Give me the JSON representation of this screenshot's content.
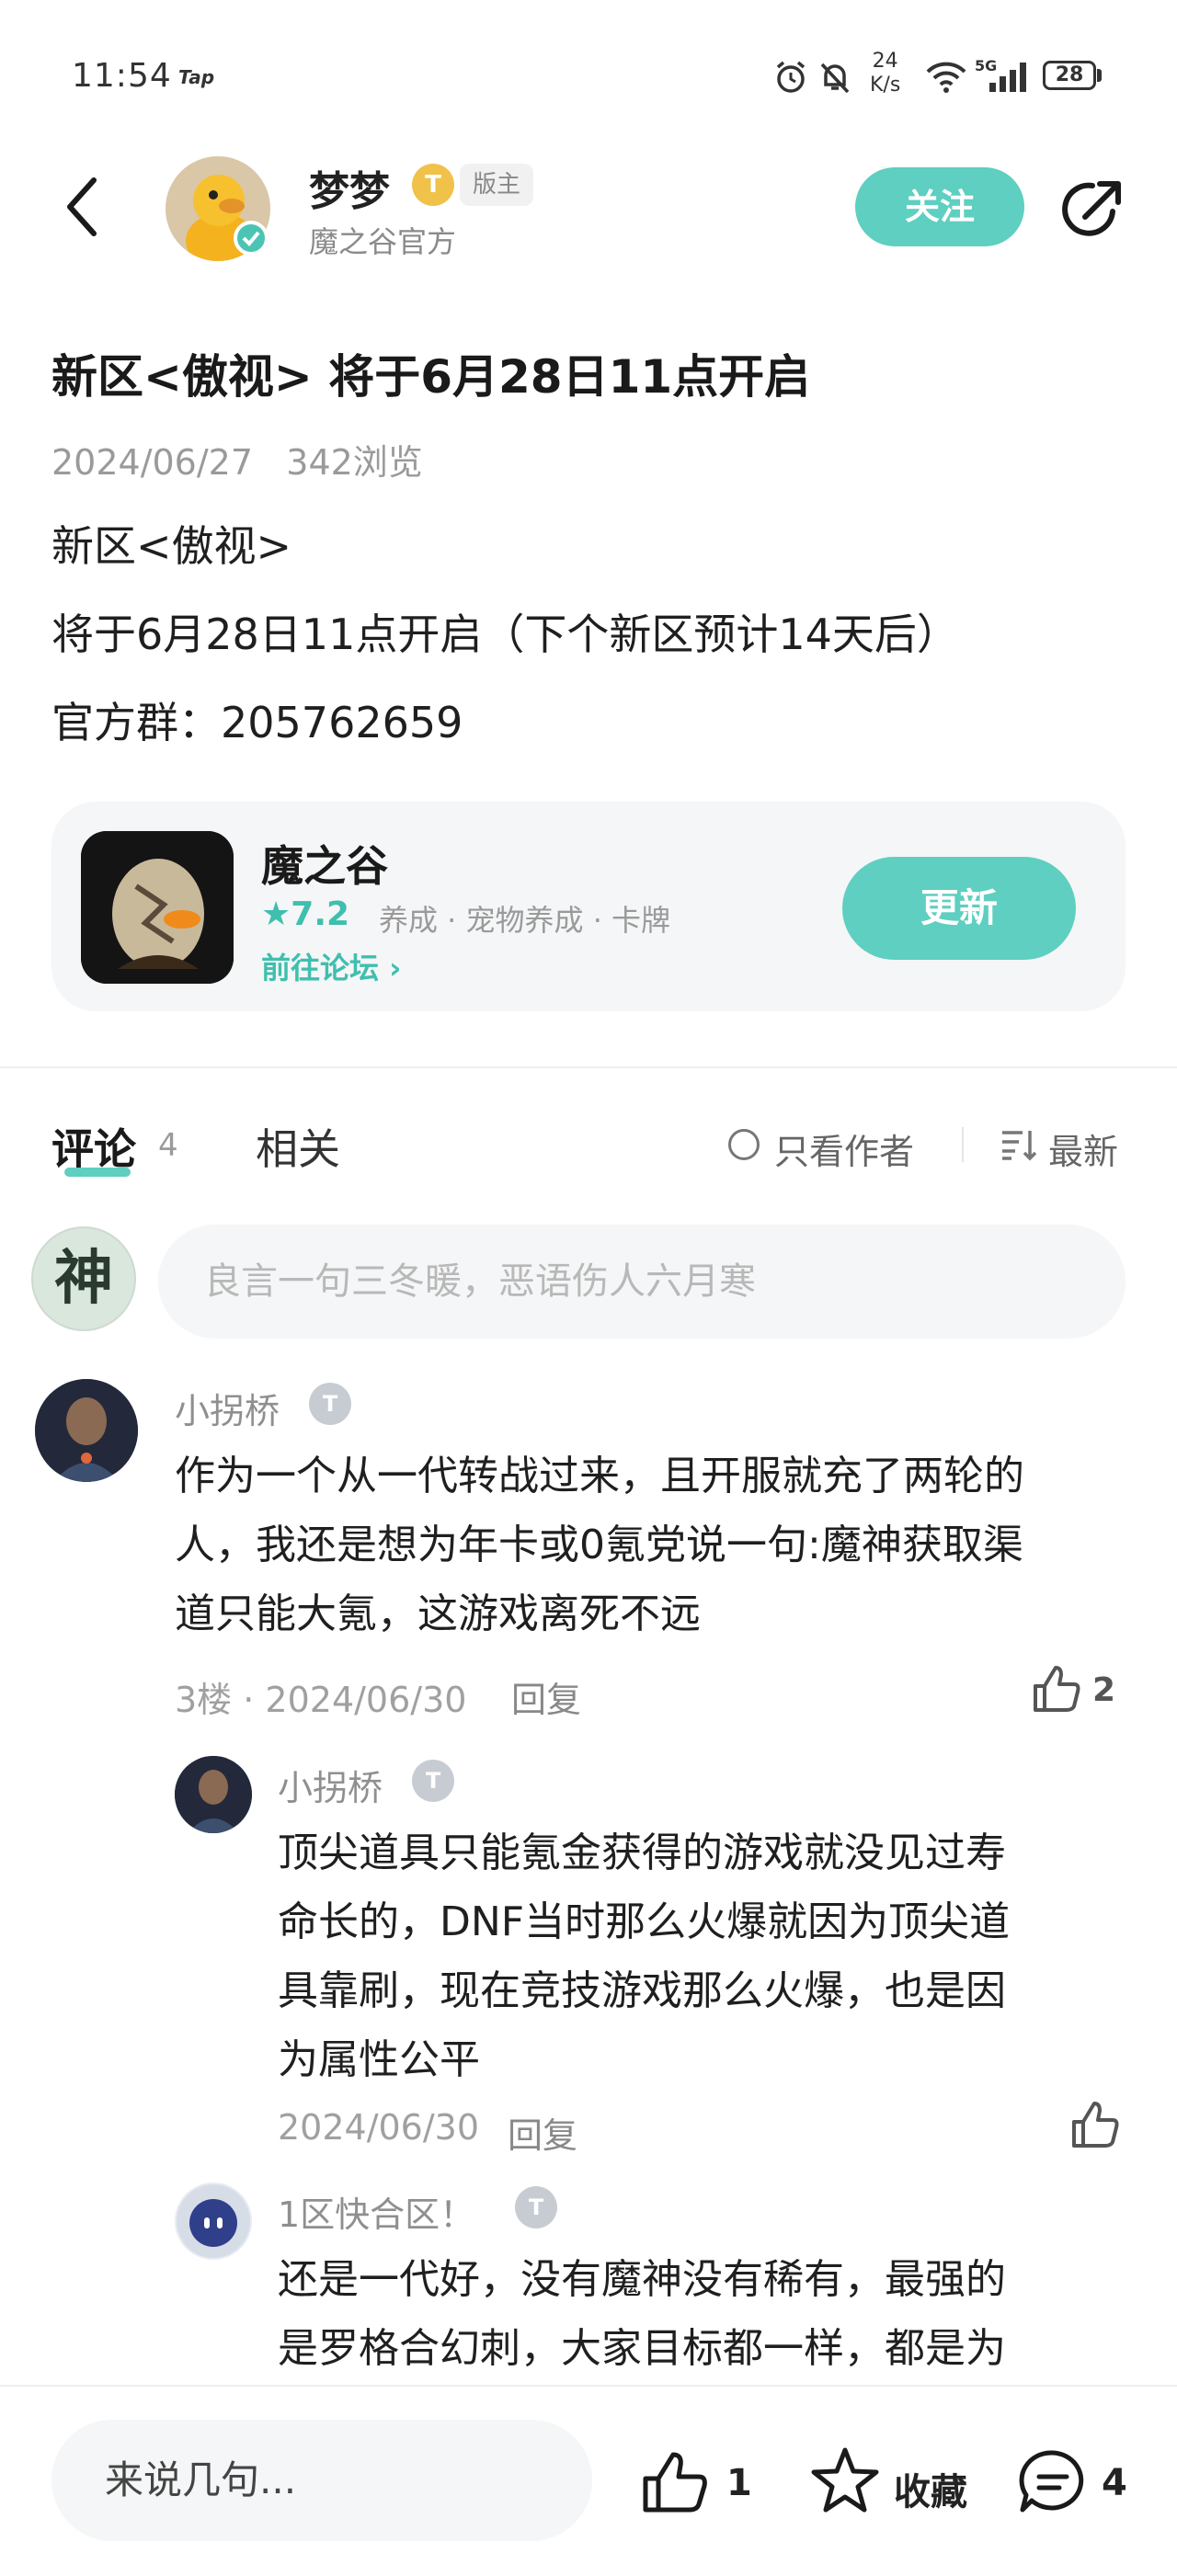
{
  "status_bar": {
    "time": "11:54",
    "tap_label": "Tap",
    "net_speed_value": "24",
    "net_speed_unit": "K/s",
    "network": "5G",
    "battery": "28"
  },
  "header": {
    "author_name": "梦梦",
    "level_badge": "T",
    "role_badge": "版主",
    "author_sub": "魔之谷官方",
    "follow_label": "关注"
  },
  "article": {
    "title": "新区<傲视> 将于6月28日11点开启",
    "date": "2024/06/27",
    "views": "342浏览",
    "body_lines": [
      "新区<傲视>",
      "将于6月28日11点开启（下个新区预计14天后）",
      "官方群：205762659"
    ]
  },
  "app_card": {
    "name": "魔之谷",
    "rating": "★7.2",
    "tags": "养成 · 宠物养成 · 卡牌",
    "forum_link": "前往论坛 ›",
    "update_label": "更新"
  },
  "tabs": {
    "comments_label": "评论",
    "comments_count": "4",
    "related_label": "相关",
    "author_only_label": "只看作者",
    "sort_label": "最新"
  },
  "comment_input": {
    "avatar_char": "神",
    "placeholder": "良言一句三冬暖，恶语伤人六月寒"
  },
  "comments": [
    {
      "user": "小拐桥",
      "badge": "T",
      "lines": [
        "作为一个从一代转战过来，且开服就充了两轮的",
        "人，我还是想为年卡或0氪党说一句:魔神获取渠",
        "道只能大氪，这游戏离死不远"
      ],
      "meta": "3楼 · 2024/06/30",
      "reply_label": "回复",
      "likes": "2"
    }
  ],
  "replies": [
    {
      "user": "小拐桥",
      "badge": "T",
      "lines": [
        "顶尖道具只能氪金获得的游戏就没见过寿",
        "命长的，DNF当时那么火爆就因为顶尖道",
        "具靠刷，现在竞技游戏那么火爆，也是因",
        "为属性公平"
      ],
      "meta": "2024/06/30",
      "reply_label": "回复"
    },
    {
      "user": "1区快合区！",
      "badge": "T",
      "lines": [
        "还是一代好，没有魔神没有稀有，最强的",
        "是罗格合幻刺，大家目标都一样，都是为"
      ]
    }
  ],
  "bottom_bar": {
    "input_placeholder": "来说几句...",
    "like_count": "1",
    "favorite_label": "收藏",
    "comment_count": "4"
  },
  "colors": {
    "accent": "#5ecfc0",
    "accent_text": "#3fbfae",
    "muted_text": "#9a9a9a",
    "card_bg": "#f5f6f7"
  }
}
